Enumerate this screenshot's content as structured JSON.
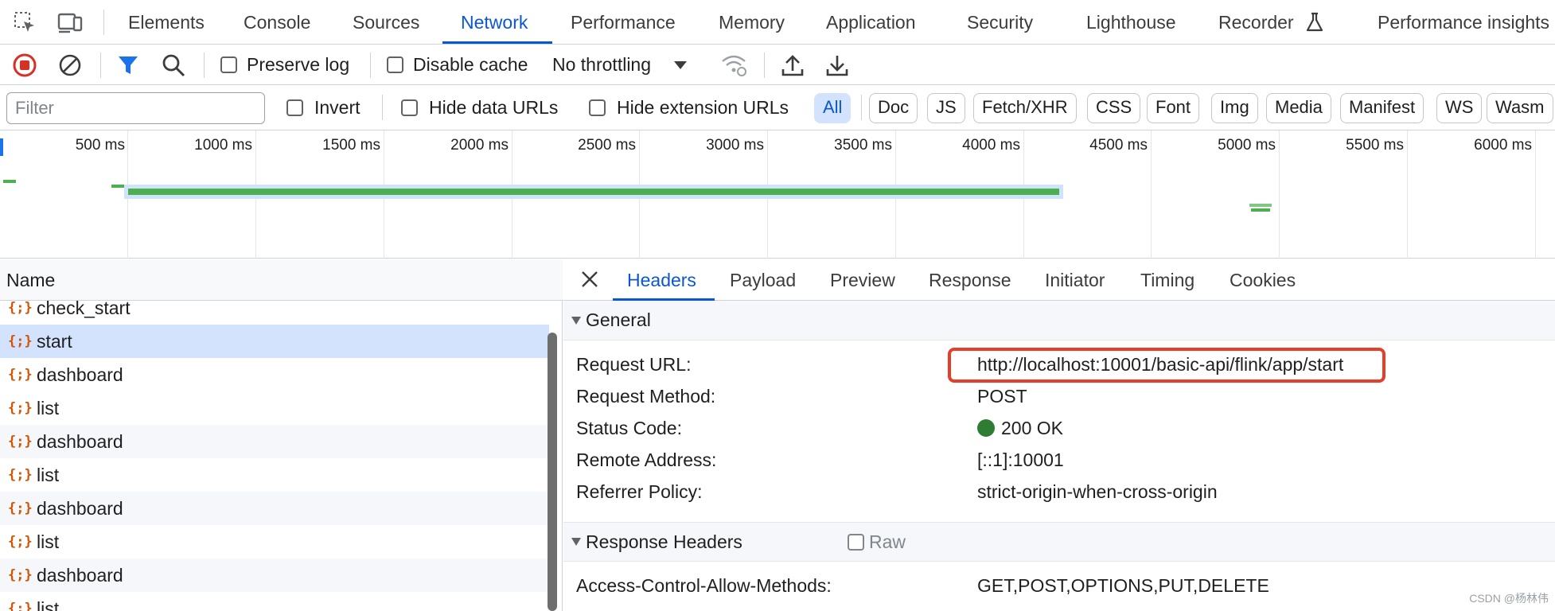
{
  "tabs": [
    "Elements",
    "Console",
    "Sources",
    "Network",
    "Performance",
    "Memory",
    "Application",
    "Security",
    "Lighthouse",
    "Recorder",
    "Performance insights"
  ],
  "active_tab": "Network",
  "toolbar": {
    "preserve_log": "Preserve log",
    "disable_cache": "Disable cache",
    "throttling": "No throttling"
  },
  "filter": {
    "placeholder": "Filter",
    "invert": "Invert",
    "hide_data_urls": "Hide data URLs",
    "hide_extension_urls": "Hide extension URLs",
    "types": [
      "All",
      "Doc",
      "JS",
      "Fetch/XHR",
      "CSS",
      "Font",
      "Img",
      "Media",
      "Manifest",
      "WS",
      "Wasm"
    ],
    "active_type": "All"
  },
  "overview": {
    "ticks": [
      "500 ms",
      "1000 ms",
      "1500 ms",
      "2000 ms",
      "2500 ms",
      "3000 ms",
      "3500 ms",
      "4000 ms",
      "4500 ms",
      "5000 ms",
      "5500 ms",
      "6000 ms"
    ]
  },
  "requests": {
    "column_name": "Name",
    "rows": [
      "check_start",
      "start",
      "dashboard",
      "list",
      "dashboard",
      "list",
      "dashboard",
      "list",
      "dashboard",
      "list"
    ],
    "selected": "start"
  },
  "details": {
    "tabs": [
      "Headers",
      "Payload",
      "Preview",
      "Response",
      "Initiator",
      "Timing",
      "Cookies"
    ],
    "active_tab": "Headers",
    "general_title": "General",
    "general": [
      {
        "key": "Request URL:",
        "value": "http://localhost:10001/basic-api/flink/app/start"
      },
      {
        "key": "Request Method:",
        "value": "POST"
      },
      {
        "key": "Status Code:",
        "value": "200 OK"
      },
      {
        "key": "Remote Address:",
        "value": "[::1]:10001"
      },
      {
        "key": "Referrer Policy:",
        "value": "strict-origin-when-cross-origin"
      }
    ],
    "response_headers_title": "Response Headers",
    "raw_label": "Raw",
    "response_headers": [
      {
        "key": "Access-Control-Allow-Methods:",
        "value": "GET,POST,OPTIONS,PUT,DELETE"
      }
    ]
  },
  "watermark": "CSDN @杨林伟",
  "colors": {
    "accent": "#0b57d0",
    "status_ok": "#2e7d32",
    "highlight": "#e53e2b",
    "waterfall": "#4caf50"
  }
}
